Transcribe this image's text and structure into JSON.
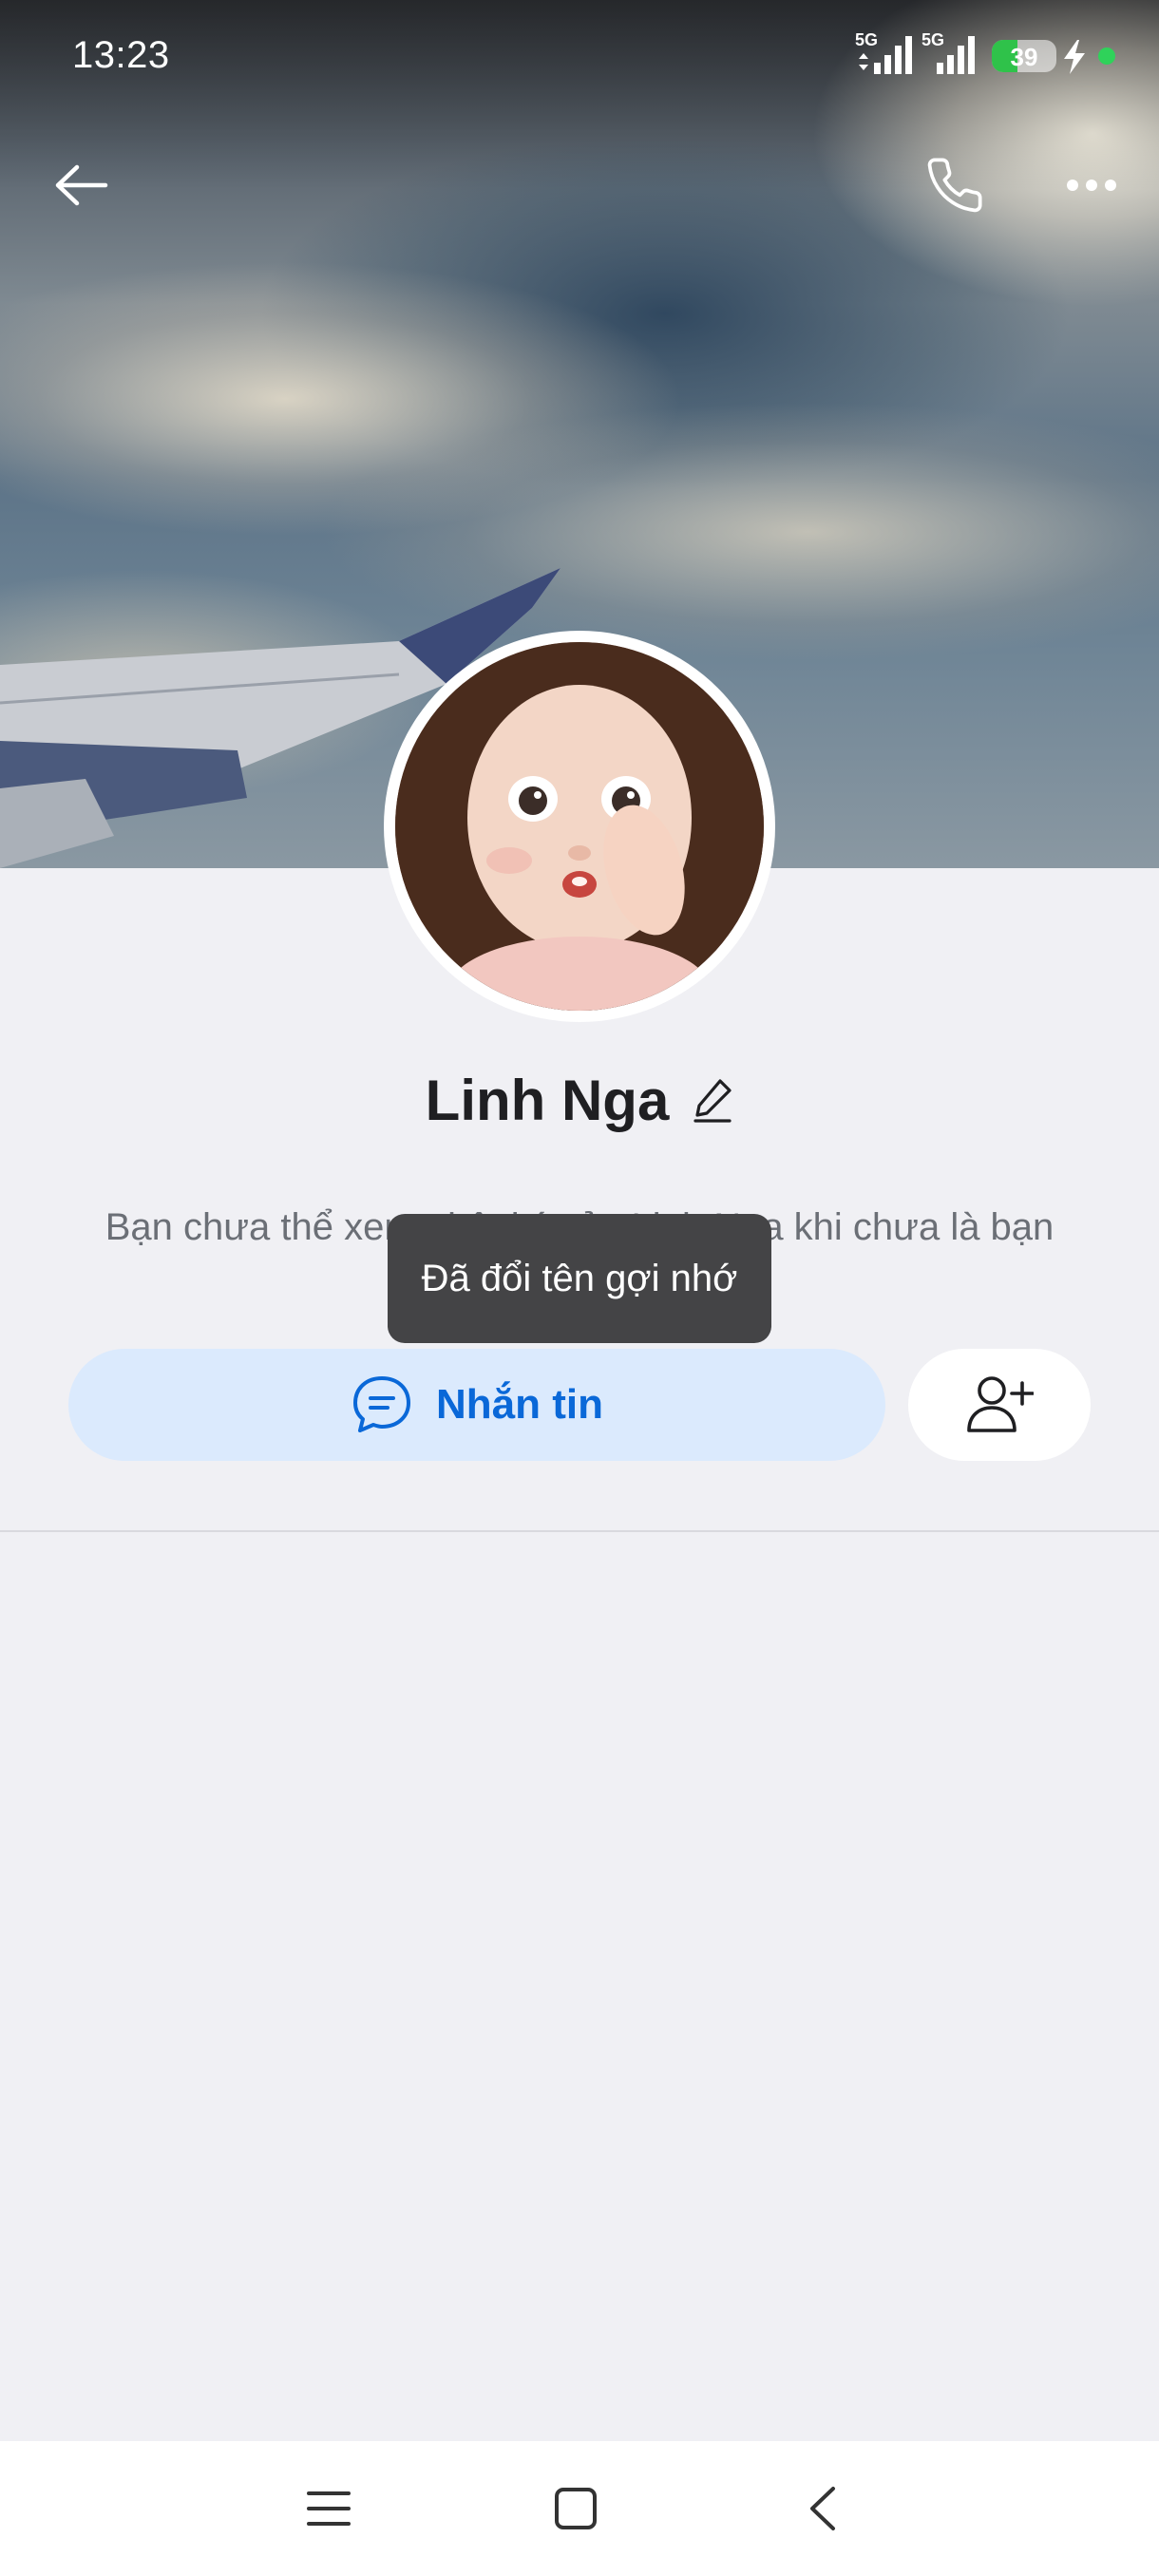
{
  "status_bar": {
    "time": "13:23",
    "network_1": "5G",
    "network_2": "5G",
    "battery_level": "39",
    "battery_fraction": 0.39,
    "charging": true
  },
  "header": {
    "back_icon": "arrow-left-icon",
    "call_icon": "phone-icon",
    "more_icon": "more-dots-icon"
  },
  "profile": {
    "name": "Linh Nga",
    "edit_icon": "pencil-icon",
    "description": "Bạn chưa thể xem nhật ký của Linh Nga khi chưa là bạn"
  },
  "toast": {
    "text": "Đã đổi tên gợi nhớ"
  },
  "actions": {
    "message_label": "Nhắn tin",
    "message_icon": "chat-bubble-icon",
    "add_friend_icon": "add-friend-icon"
  },
  "colors": {
    "accent": "#0a68d8",
    "accent_bg": "#dbeafd",
    "page_bg": "#f0f0f4",
    "toast_bg": "#444446"
  },
  "nav_bar": {
    "menu_icon": "menu-icon",
    "home_icon": "home-square-icon",
    "back_icon": "back-chevron-icon"
  }
}
